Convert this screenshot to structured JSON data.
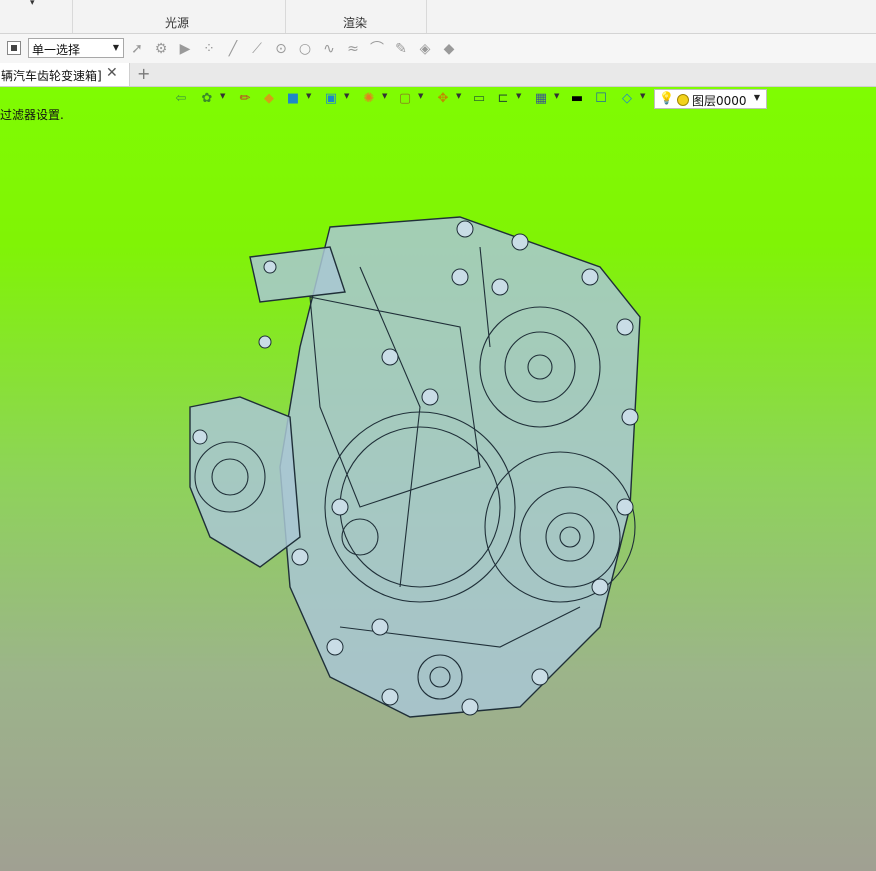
{
  "ribbon": {
    "groups": [
      {
        "label": ""
      },
      {
        "label": "光源"
      },
      {
        "label": "渲染"
      }
    ]
  },
  "select_bar": {
    "filter_value": "单一选择",
    "tools": [
      "cursor-select-icon",
      "paint-select-icon",
      "play-icon",
      "point-cloud-icon",
      "line-icon",
      "line-point-icon",
      "circle-point-icon",
      "circle-icon",
      "spline-icon",
      "wave-icon",
      "arc-icon",
      "pen-icon",
      "layer-stack-icon",
      "layer-stack-2-icon"
    ]
  },
  "tabs": {
    "active_label": "辆汽车齿轮变速箱]",
    "close_glyph": "✕",
    "add_glyph": "+"
  },
  "viewport": {
    "hint": "过滤器设置.",
    "layer": {
      "name": "图层0000"
    },
    "colors": {
      "top": "#7ffc02",
      "bottom": "#a0a092",
      "model_fill": "#a9c7d4",
      "model_edge": "#1f2f38"
    }
  }
}
